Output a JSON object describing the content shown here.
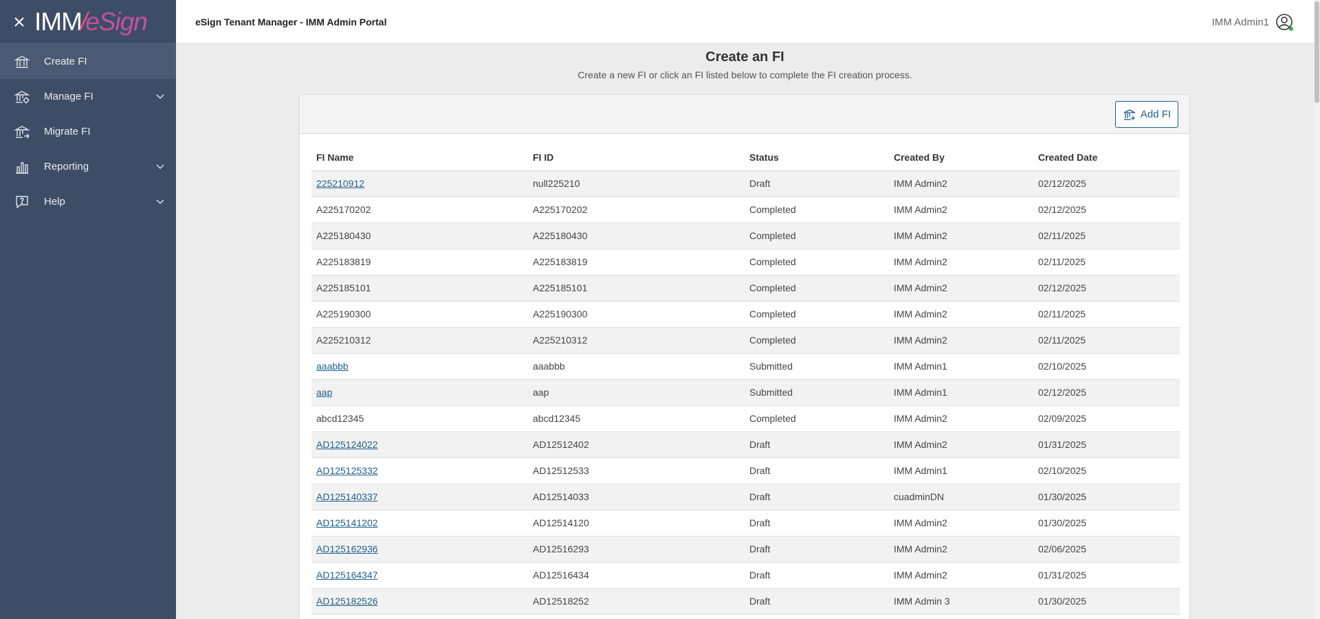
{
  "header": {
    "title": "eSign Tenant Manager - IMM Admin Portal",
    "user_name": "IMM Admin1"
  },
  "brand": {
    "part1": "IMM",
    "slash": "/",
    "part2": "eSign"
  },
  "sidebar": {
    "items": [
      {
        "label": "Create FI",
        "icon": "bank-icon",
        "active": true
      },
      {
        "label": "Manage FI",
        "icon": "bank-gear-icon",
        "expandable": true
      },
      {
        "label": "Migrate FI",
        "icon": "bank-arrow-icon"
      },
      {
        "label": "Reporting",
        "icon": "bar-chart-icon",
        "expandable": true
      },
      {
        "label": "Help",
        "icon": "help-icon",
        "expandable": true
      }
    ]
  },
  "main": {
    "title": "Create an FI",
    "subtitle": "Create a new FI or click an FI listed below to complete the FI creation process.",
    "add_button": "Add FI",
    "columns": [
      "FI Name",
      "FI ID",
      "Status",
      "Created By",
      "Created Date"
    ],
    "rows": [
      {
        "name": "225210912",
        "id": "null225210",
        "status": "Draft",
        "created_by": "IMM Admin2",
        "date": "02/12/2025",
        "link": true
      },
      {
        "name": "A225170202",
        "id": "A225170202",
        "status": "Completed",
        "created_by": "IMM Admin2",
        "date": "02/12/2025",
        "link": false
      },
      {
        "name": "A225180430",
        "id": "A225180430",
        "status": "Completed",
        "created_by": "IMM Admin2",
        "date": "02/11/2025",
        "link": false
      },
      {
        "name": "A225183819",
        "id": "A225183819",
        "status": "Completed",
        "created_by": "IMM Admin2",
        "date": "02/11/2025",
        "link": false
      },
      {
        "name": "A225185101",
        "id": "A225185101",
        "status": "Completed",
        "created_by": "IMM Admin2",
        "date": "02/12/2025",
        "link": false
      },
      {
        "name": "A225190300",
        "id": "A225190300",
        "status": "Completed",
        "created_by": "IMM Admin2",
        "date": "02/11/2025",
        "link": false
      },
      {
        "name": "A225210312",
        "id": "A225210312",
        "status": "Completed",
        "created_by": "IMM Admin2",
        "date": "02/11/2025",
        "link": false
      },
      {
        "name": "aaabbb",
        "id": "aaabbb",
        "status": "Submitted",
        "created_by": "IMM Admin1",
        "date": "02/10/2025",
        "link": true
      },
      {
        "name": "aap",
        "id": "aap",
        "status": "Submitted",
        "created_by": "IMM Admin1",
        "date": "02/12/2025",
        "link": true
      },
      {
        "name": "abcd12345",
        "id": "abcd12345",
        "status": "Completed",
        "created_by": "IMM Admin2",
        "date": "02/09/2025",
        "link": false
      },
      {
        "name": "AD125124022",
        "id": "AD12512402",
        "status": "Draft",
        "created_by": "IMM Admin2",
        "date": "01/31/2025",
        "link": true
      },
      {
        "name": "AD125125332",
        "id": "AD12512533",
        "status": "Draft",
        "created_by": "IMM Admin1",
        "date": "02/10/2025",
        "link": true
      },
      {
        "name": "AD125140337",
        "id": "AD12514033",
        "status": "Draft",
        "created_by": "cuadminDN",
        "date": "01/30/2025",
        "link": true
      },
      {
        "name": "AD125141202",
        "id": "AD12514120",
        "status": "Draft",
        "created_by": "IMM Admin2",
        "date": "01/30/2025",
        "link": true
      },
      {
        "name": "AD125162936",
        "id": "AD12516293",
        "status": "Draft",
        "created_by": "IMM Admin2",
        "date": "02/06/2025",
        "link": true
      },
      {
        "name": "AD125164347",
        "id": "AD12516434",
        "status": "Draft",
        "created_by": "IMM Admin2",
        "date": "01/31/2025",
        "link": true
      },
      {
        "name": "AD125182526",
        "id": "AD12518252",
        "status": "Draft",
        "created_by": "IMM Admin 3",
        "date": "01/30/2025",
        "link": true
      }
    ]
  },
  "colors": {
    "sidebar_bg": "#3e4d66",
    "link": "#1e5e8c",
    "status_online": "#2fb24c"
  }
}
